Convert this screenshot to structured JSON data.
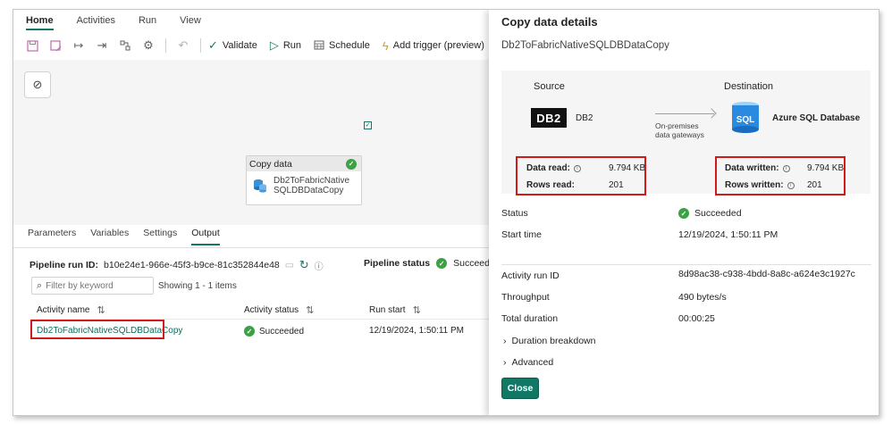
{
  "menu": {
    "tabs": [
      "Home",
      "Activities",
      "Run",
      "View"
    ]
  },
  "toolbar": {
    "validate": "Validate",
    "run": "Run",
    "schedule": "Schedule",
    "add_trigger": "Add trigger (preview)"
  },
  "canvas": {
    "activity_type": "Copy data",
    "activity_name_line1": "Db2ToFabricNative",
    "activity_name_line2": "SQLDBDataCopy"
  },
  "bottom_tabs": [
    "Parameters",
    "Variables",
    "Settings",
    "Output"
  ],
  "output": {
    "run_id_label": "Pipeline run ID:",
    "run_id_value": "b10e24e1-966e-45f3-b9ce-81c352844e48",
    "pipeline_status_label": "Pipeline status",
    "pipeline_status_value": "Succeeded",
    "filter_placeholder": "Filter by keyword",
    "showing": "Showing 1 - 1 items",
    "columns": [
      "Activity name",
      "Activity status",
      "Run start"
    ],
    "row": {
      "activity_name": "Db2ToFabricNativeSQLDBDataCopy",
      "activity_status": "Succeeded",
      "run_start": "12/19/2024, 1:50:11 PM"
    }
  },
  "panel": {
    "title": "Copy data details",
    "subtitle": "Db2ToFabricNativeSQLDBDataCopy",
    "source_label": "Source",
    "destination_label": "Destination",
    "source_logo": "DB2",
    "source_name": "DB2",
    "gateway_line1": "On-premises",
    "gateway_line2": "data gateways",
    "dest_logo": "SQL",
    "dest_name": "Azure SQL Database",
    "data_read_label": "Data read:",
    "data_read_value": "9.794 KB",
    "rows_read_label": "Rows read:",
    "rows_read_value": "201",
    "data_written_label": "Data written:",
    "data_written_value": "9.794 KB",
    "rows_written_label": "Rows written:",
    "rows_written_value": "201",
    "status_label": "Status",
    "status_value": "Succeeded",
    "start_time_label": "Start time",
    "start_time_value": "12/19/2024, 1:50:11 PM",
    "activity_run_id_label": "Activity run ID",
    "activity_run_id_value": "8d98ac38-c938-4bdd-8a8c-a624e3c1927c",
    "throughput_label": "Throughput",
    "throughput_value": "490 bytes/s",
    "total_duration_label": "Total duration",
    "total_duration_value": "00:00:25",
    "duration_breakdown": "Duration breakdown",
    "advanced": "Advanced",
    "close": "Close"
  },
  "colors": {
    "accent": "#117865",
    "success": "#3ca145",
    "highlight": "#d11b1b"
  }
}
